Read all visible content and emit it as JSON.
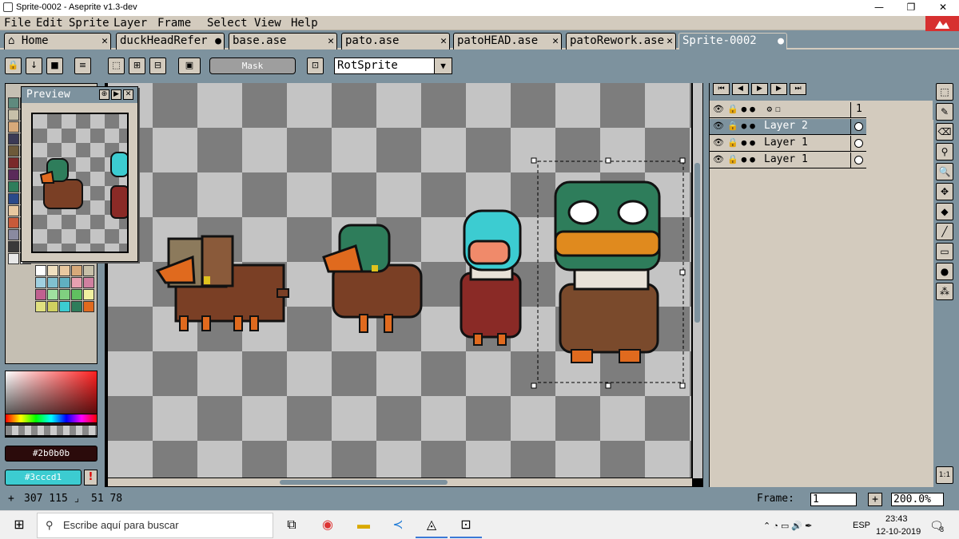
{
  "window": {
    "title": "Sprite-0002 - Aseprite v1.3-dev",
    "min": "—",
    "max": "❐",
    "close": "✕"
  },
  "menu": [
    "File",
    "Edit",
    "Sprite",
    "Layer",
    "Frame",
    "Select",
    "View",
    "Help"
  ],
  "tabs": [
    {
      "label": "Home",
      "close": "✕"
    },
    {
      "label": "duckHeadRefer",
      "close": "●"
    },
    {
      "label": "base.ase",
      "close": "✕"
    },
    {
      "label": "pato.ase",
      "close": "✕"
    },
    {
      "label": "patoHEAD.ase",
      "close": "✕"
    },
    {
      "label": "patoRework.ase",
      "close": "✕"
    },
    {
      "label": "Sprite-0002",
      "close": "●"
    }
  ],
  "toolbar": {
    "mask_label": "Mask",
    "rotation_algorithm": "RotSprite"
  },
  "preview": {
    "title": "Preview"
  },
  "colors": {
    "foreground": "#2b0b0b",
    "background": "#3cccd1",
    "foreground_label": "#2b0b0b",
    "background_label": "#3cccd1",
    "warning": "!"
  },
  "timeline": {
    "frame_number": "1",
    "layers": [
      {
        "name": "Layer 2",
        "selected": true
      },
      {
        "name": "Layer 1",
        "selected": false
      },
      {
        "name": "Layer 1",
        "selected": false
      }
    ]
  },
  "status": {
    "cursor": "307 115",
    "selection_size": "51 78",
    "frame_label": "Frame:",
    "frame_value": "1",
    "zoom": "200.0%"
  },
  "taskbar": {
    "search_placeholder": "Escribe aquí para buscar",
    "lang": "ESP",
    "time": "23:43",
    "date": "12-10-2019",
    "notifications": "8"
  }
}
